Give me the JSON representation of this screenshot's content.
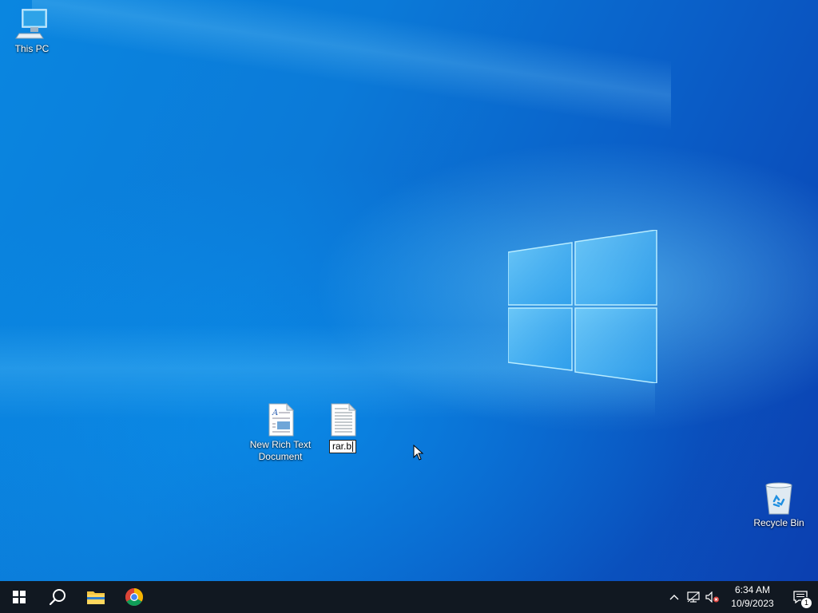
{
  "desktop": {
    "icons": [
      {
        "label": "This PC"
      },
      {
        "label": "New Rich Text Document"
      },
      {
        "label": "rar.b",
        "rename_value": "rar.b"
      },
      {
        "label": "Recycle Bin"
      }
    ]
  },
  "taskbar": {
    "start_icon": "windows-start-icon",
    "search_icon": "search-icon",
    "pinned": [
      {
        "icon": "file-explorer-icon"
      },
      {
        "icon": "chrome-icon"
      }
    ],
    "tray": {
      "icons": [
        "chevron-up-icon",
        "network-icon",
        "volume-muted-icon"
      ],
      "time": "6:34 AM",
      "date": "10/9/2023",
      "notification_count": "1"
    }
  },
  "colors": {
    "accent": "#0a78d7",
    "taskbar": "#111821"
  }
}
